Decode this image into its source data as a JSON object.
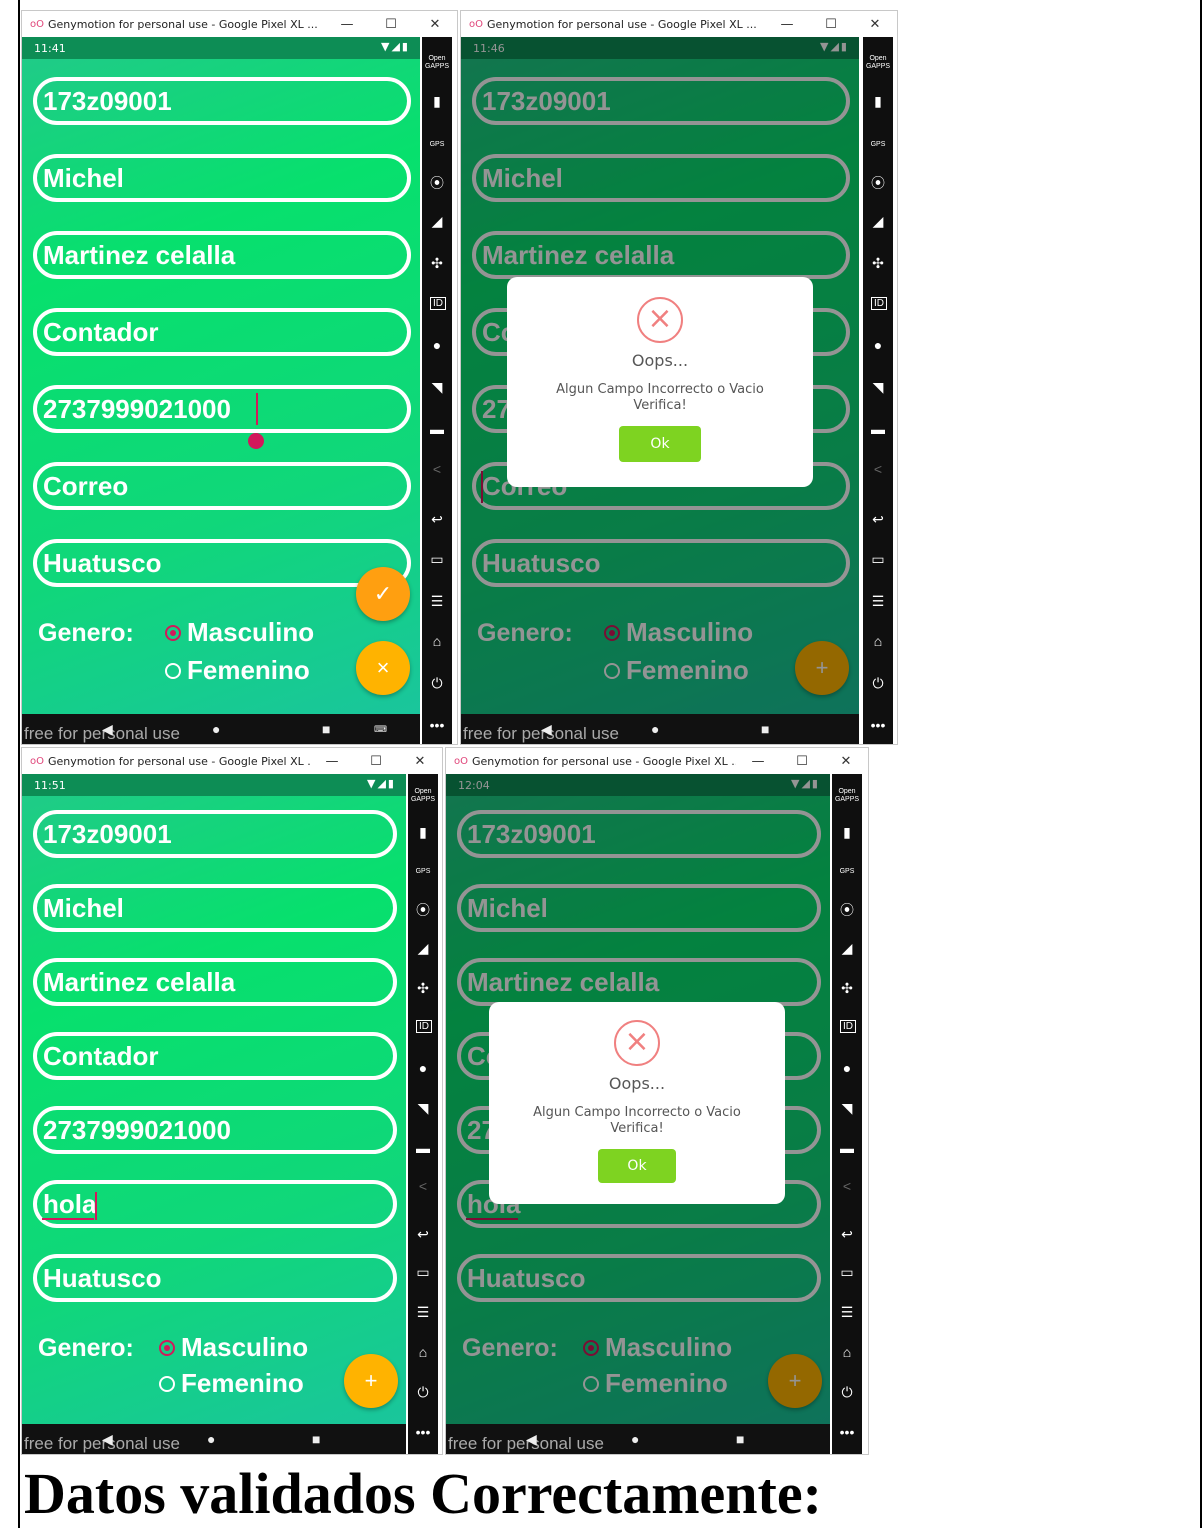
{
  "windows": [
    {
      "title": "Genymotion for personal use - Google Pixel XL ...",
      "time": "11:41",
      "fields": [
        "173z09001",
        "Michel",
        "Martinez celalla",
        "Contador",
        "2737999021000",
        "Correo",
        "Huatusco"
      ],
      "genero_label": "Genero:",
      "radio_masculino": "Masculino",
      "radio_femenino": "Femenino",
      "fab_top_symbol": "✓",
      "fab_bottom_symbol": "×",
      "watermark": "free for personal use"
    },
    {
      "title": "Genymotion for personal use - Google Pixel XL ...",
      "time": "11:46",
      "fields": [
        "173z09001",
        "Michel",
        "Martinez celalla",
        "Co",
        "27",
        "Correo",
        "Huatusco"
      ],
      "genero_label": "Genero:",
      "radio_masculino": "Masculino",
      "radio_femenino": "Femenino",
      "fab_symbol": "+",
      "watermark": "free for personal use",
      "dialog": {
        "icon": "×",
        "title": "Oops...",
        "message_line1": "Algun Campo Incorrecto o Vacio",
        "message_line2": "Verifica!",
        "ok": "Ok"
      }
    },
    {
      "title": "Genymotion for personal use - Google Pixel XL ...",
      "time": "11:51",
      "fields": [
        "173z09001",
        "Michel",
        "Martinez celalla",
        "Contador",
        "2737999021000",
        "hola",
        "Huatusco"
      ],
      "genero_label": "Genero:",
      "radio_masculino": "Masculino",
      "radio_femenino": "Femenino",
      "fab_symbol": "+",
      "watermark": "free for personal use"
    },
    {
      "title": "Genymotion for personal use - Google Pixel XL ...",
      "time": "12:04",
      "fields": [
        "173z09001",
        "Michel",
        "Martinez celalla",
        "Co",
        "27",
        "hola",
        "Huatusco"
      ],
      "genero_label": "Genero:",
      "radio_masculino": "Masculino",
      "radio_femenino": "Femenino",
      "fab_symbol": "+",
      "watermark": "free for personal use",
      "dialog": {
        "icon": "×",
        "title": "Oops...",
        "message_line1": "Algun Campo Incorrecto o Vacio",
        "message_line2": "Verifica!",
        "ok": "Ok"
      }
    }
  ],
  "titlebar_buttons": {
    "minimize": "—",
    "maximize": "☐",
    "close": "✕"
  },
  "sidebar": {
    "open_gapps": "Open GAPPS",
    "gps": "GPS",
    "id": "ID"
  },
  "footer_heading": "Datos validados Correctamente:",
  "colors": {
    "accent_pink": "#d2185b",
    "fab_yellow": "#ffb300",
    "ok_green": "#7ed321",
    "error_red": "#f08080"
  }
}
